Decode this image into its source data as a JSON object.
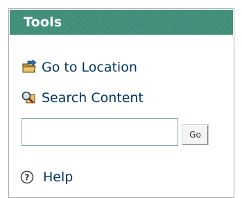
{
  "panel": {
    "title": "Tools"
  },
  "links": {
    "go_to_location": "Go to Location",
    "search_content": "Search Content",
    "help": "Help"
  },
  "search": {
    "value": "",
    "go_label": "Go"
  },
  "icons": {
    "go_to_location": "folder-arrow-icon",
    "search_content": "magnifier-folder-icon",
    "help": "question-circle-icon"
  },
  "colors": {
    "header_bg": "#3d8f7a",
    "link_text": "#003366"
  }
}
